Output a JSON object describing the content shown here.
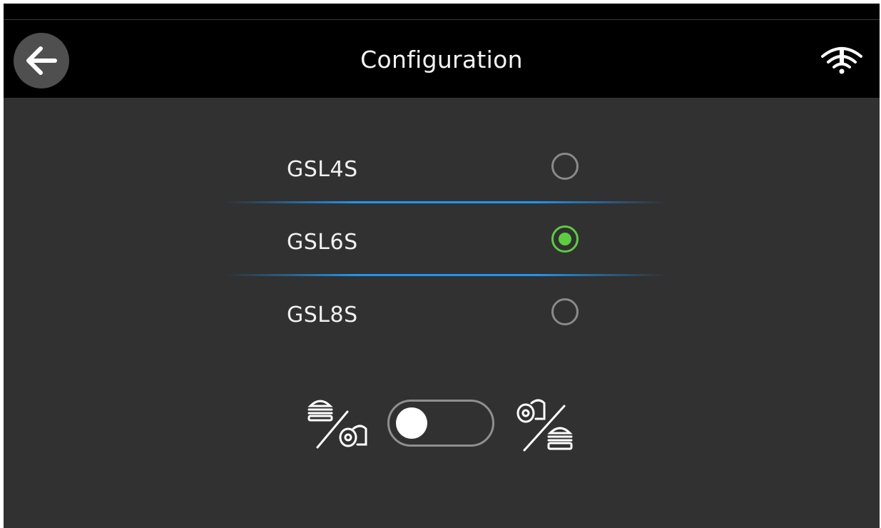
{
  "header": {
    "title": "Configuration",
    "back_icon": "arrow-left-icon",
    "status_icon": "wifi-warning-icon"
  },
  "model_options": [
    {
      "label": "GSL4S",
      "selected": false
    },
    {
      "label": "GSL6S",
      "selected": true
    },
    {
      "label": "GSL8S",
      "selected": false
    }
  ],
  "mode_toggle": {
    "left_icon": "burger-over-eggs-icon",
    "right_icon": "eggs-over-burger-icon",
    "on": false
  },
  "colors": {
    "background": "#313131",
    "header": "#000000",
    "selected": "#5ccd3f",
    "divider": "#2196f3"
  }
}
